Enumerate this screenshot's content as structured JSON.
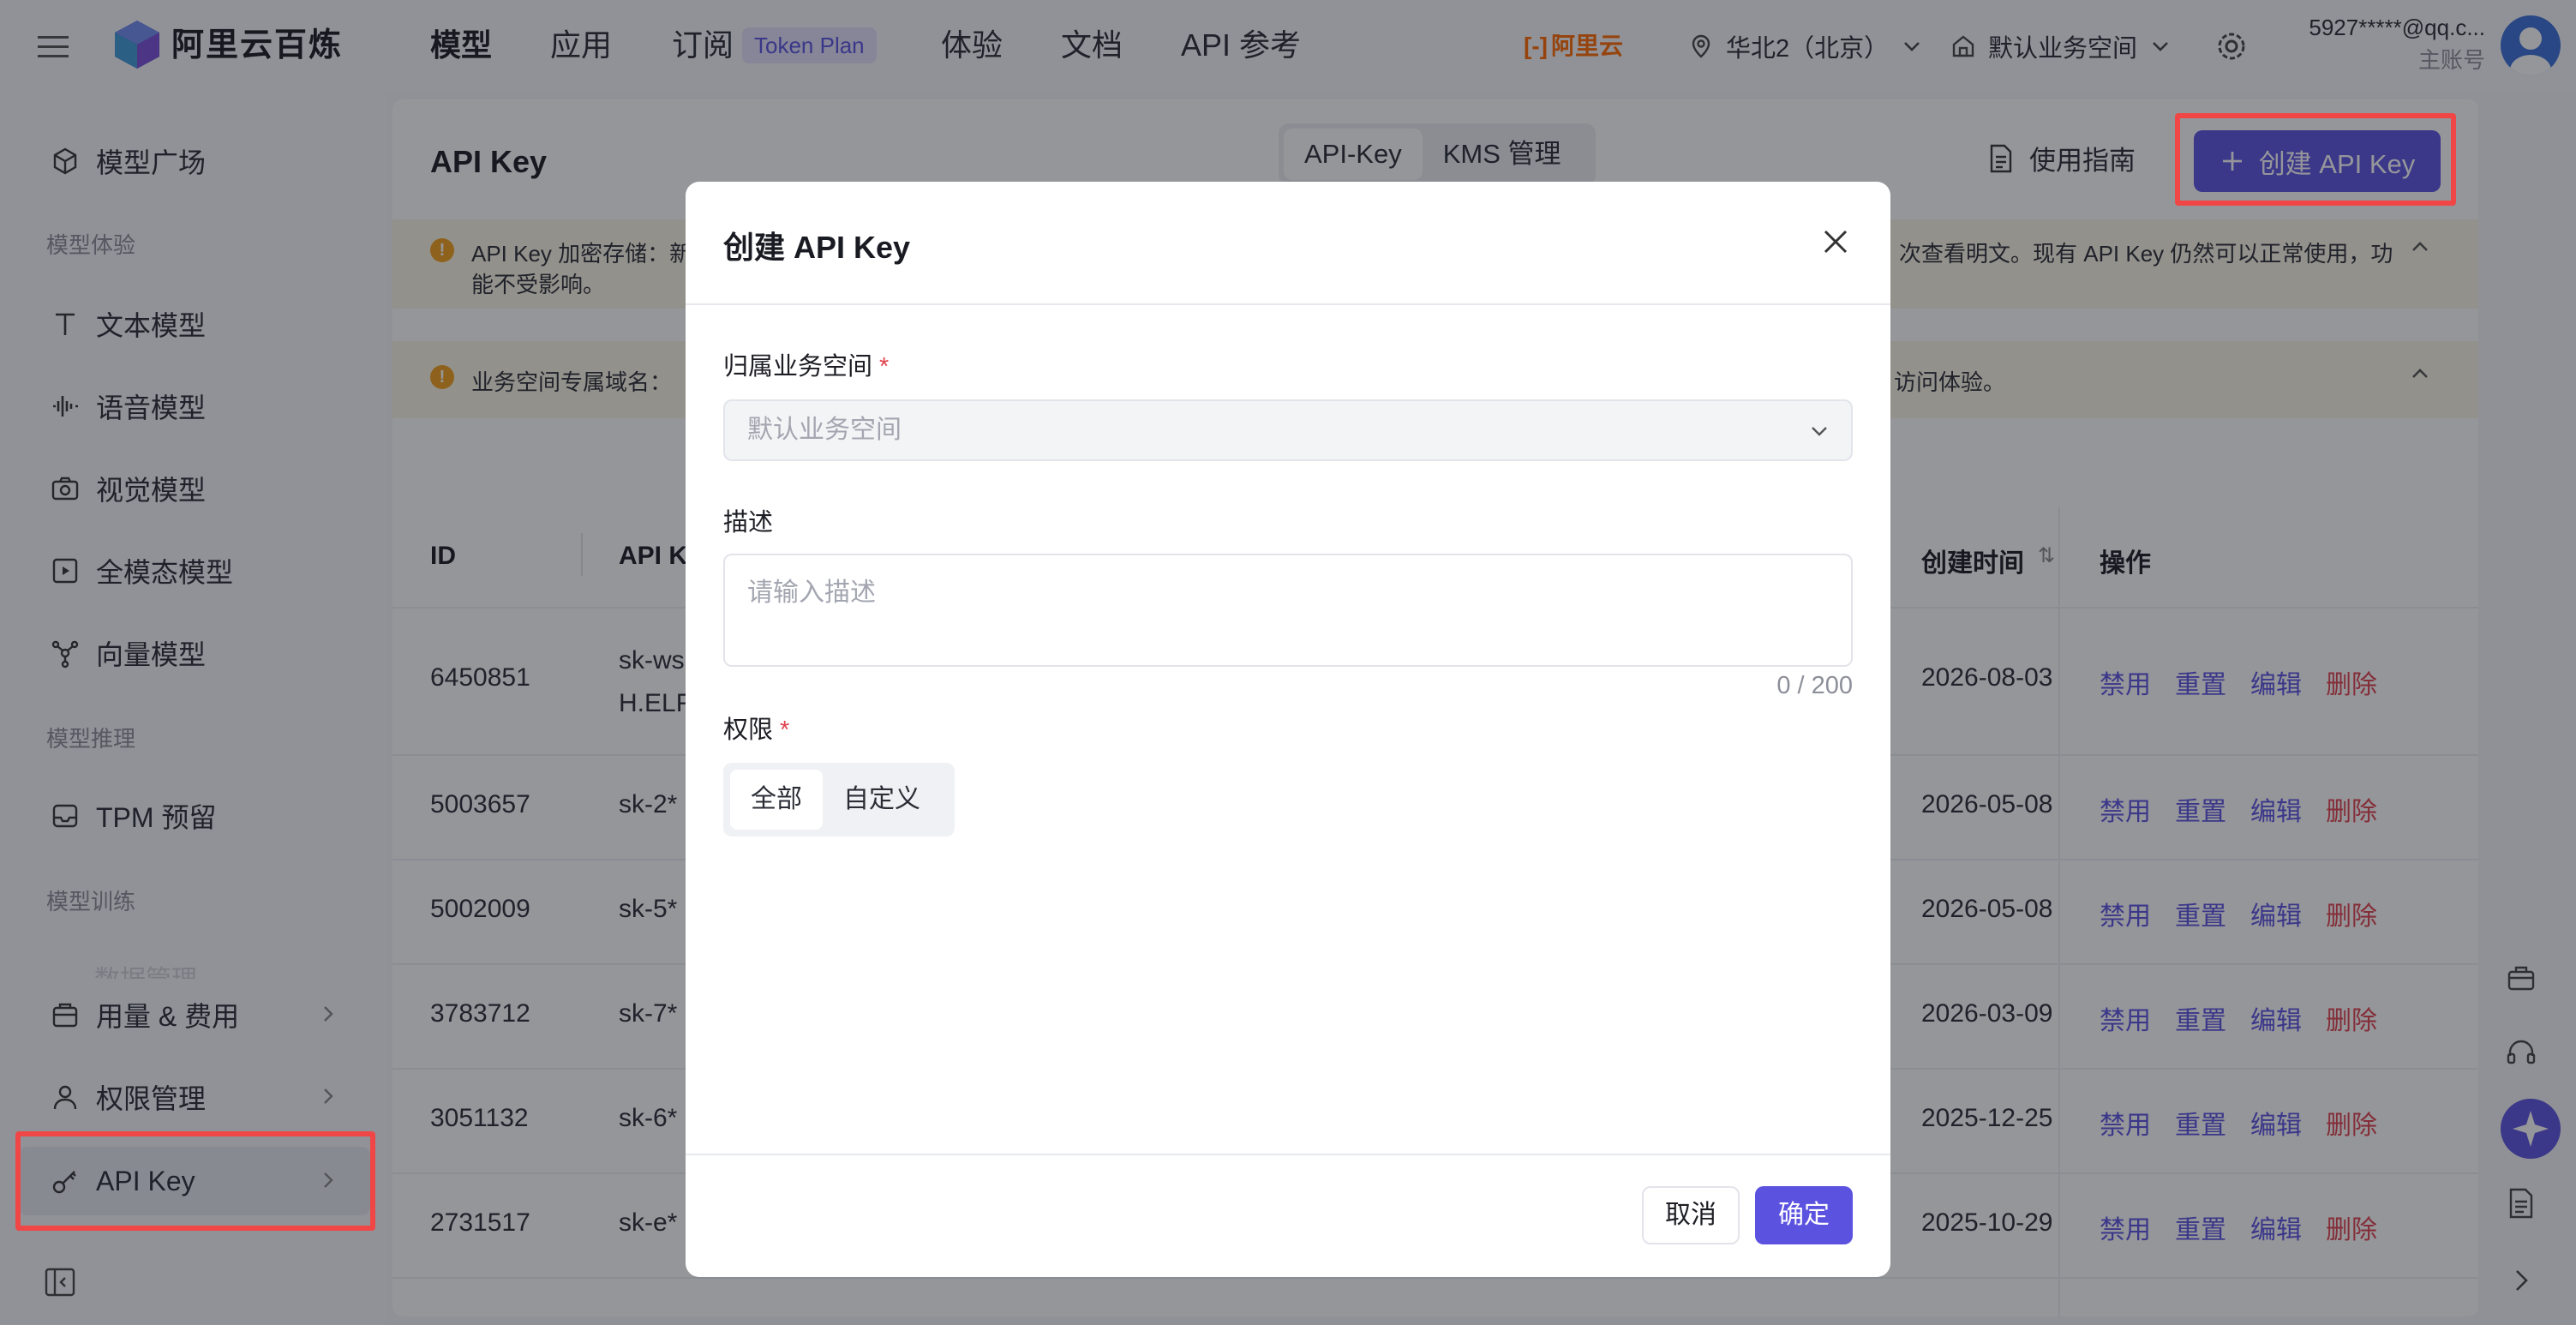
{
  "topbar": {
    "brand": "阿里云百炼",
    "nav": [
      {
        "label": "模型",
        "active": true
      },
      {
        "label": "应用"
      },
      {
        "label": "订阅"
      },
      {
        "label": "体验"
      },
      {
        "label": "文档"
      },
      {
        "label": "API 参考"
      }
    ],
    "token_badge": "Token Plan",
    "aliyun_logo": "阿里云",
    "region": "华北2（北京）",
    "workspace": "默认业务空间",
    "account_email": "5927*****@qq.c...",
    "account_role": "主账号"
  },
  "sidebar": {
    "items_top": [
      {
        "label": "模型广场",
        "icon": "model-square-icon"
      }
    ],
    "group_experience": "模型体验",
    "experience_items": [
      {
        "label": "文本模型",
        "icon": "text-icon"
      },
      {
        "label": "语音模型",
        "icon": "audio-wave-icon"
      },
      {
        "label": "视觉模型",
        "icon": "camera-icon"
      },
      {
        "label": "全模态模型",
        "icon": "omni-icon"
      },
      {
        "label": "向量模型",
        "icon": "vector-icon"
      }
    ],
    "group_inference": "模型推理",
    "inference_items": [
      {
        "label": "TPM 预留",
        "icon": "inbox-icon"
      }
    ],
    "group_training": "模型训练",
    "training_faded": "数据管理",
    "bottom_items": [
      {
        "label": "用量 & 费用",
        "icon": "bag-icon"
      },
      {
        "label": "权限管理",
        "icon": "user-icon"
      },
      {
        "label": "API Key",
        "icon": "key-icon"
      }
    ]
  },
  "main": {
    "title": "API Key",
    "tabs": [
      {
        "label": "API-Key",
        "active": true
      },
      {
        "label": "KMS 管理"
      }
    ],
    "guide_label": "使用指南",
    "create_label": "创建 API Key",
    "notice1_prefix": "API Key 加密存储：新",
    "notice1_suffix": "次查看明文。现有 API Key 仍然可以正常使用，功",
    "notice1_line2": "能不受影响。",
    "notice2_prefix": "业务空间专属域名：",
    "notice2_suffix": "访问体验。",
    "table": {
      "headers": {
        "id": "ID",
        "key": "API K",
        "created": "创建时间",
        "ops": "操作"
      },
      "rows": [
        {
          "id": "6450851",
          "key": "sk-ws",
          "key2": "H.ELF",
          "created": "2026-08-03"
        },
        {
          "id": "5003657",
          "key": "sk-2*",
          "created": "2026-05-08"
        },
        {
          "id": "5002009",
          "key": "sk-5*",
          "created": "2026-05-08"
        },
        {
          "id": "3783712",
          "key": "sk-7*",
          "created": "2026-03-09"
        },
        {
          "id": "3051132",
          "key": "sk-6*",
          "created": "2025-12-25"
        },
        {
          "id": "2731517",
          "key": "sk-e*",
          "created": "2025-10-29"
        }
      ],
      "actions": {
        "disable": "禁用",
        "reset": "重置",
        "edit": "编辑",
        "delete": "删除"
      }
    }
  },
  "modal": {
    "title": "创建 API Key",
    "workspace_label": "归属业务空间",
    "workspace_value": "默认业务空间",
    "desc_label": "描述",
    "desc_placeholder": "请输入描述",
    "desc_counter": "0 / 200",
    "perm_label": "权限",
    "perm_options": [
      {
        "label": "全部",
        "active": true
      },
      {
        "label": "自定义"
      }
    ],
    "cancel": "取消",
    "ok": "确定"
  },
  "colors": {
    "accent": "#5b52e0",
    "danger": "#e0434e",
    "highlight": "#f04646",
    "notice_bg": "#fbf6e4"
  }
}
